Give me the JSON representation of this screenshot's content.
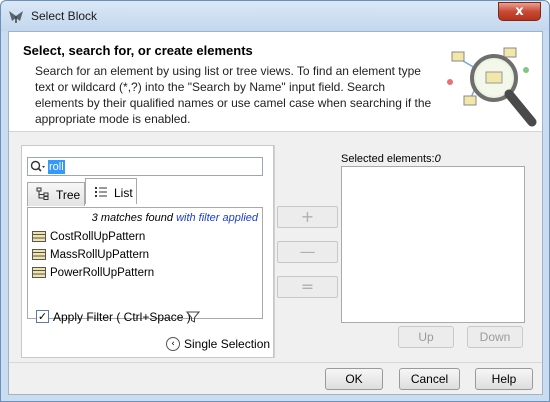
{
  "window": {
    "title": "Select Block",
    "close_glyph": "x"
  },
  "header": {
    "title": "Select, search for, or create elements",
    "description": "Search for an element by using list or tree views. To find an element type text or wildcard (*,?) into the \"Search by Name\" input field. Search elements by their qualified names or use camel case when searching if the appropriate mode is enabled."
  },
  "search": {
    "value": "roll",
    "icon": "search-icon"
  },
  "tabs": [
    {
      "label": "Tree",
      "icon": "tree-icon",
      "active": false
    },
    {
      "label": "List",
      "icon": "list-icon",
      "active": true
    }
  ],
  "results": {
    "matches_text": "3 matches found",
    "filter_text": "with filter applied",
    "items": [
      {
        "label": "CostRollUpPattern",
        "icon": "block-icon"
      },
      {
        "label": "MassRollUpPattern",
        "icon": "block-icon"
      },
      {
        "label": "PowerRollUpPattern",
        "icon": "block-icon"
      }
    ]
  },
  "apply_filter": {
    "label": "Apply Filter ( Ctrl+Space )",
    "checked": true,
    "check_glyph": "✓"
  },
  "single_selection": {
    "label": "Single Selection",
    "glyph": "‹"
  },
  "move_buttons": {
    "add": "+",
    "remove": "—",
    "remove_all": "="
  },
  "selected": {
    "label": "Selected elements:",
    "count": "0"
  },
  "order_buttons": {
    "up": "Up",
    "down": "Down"
  },
  "footer": {
    "ok": "OK",
    "cancel": "Cancel",
    "help": "Help"
  },
  "colors": {
    "accent": "#3399ff",
    "filter_link": "#1a3fd0",
    "close_button": "#c74a34"
  }
}
